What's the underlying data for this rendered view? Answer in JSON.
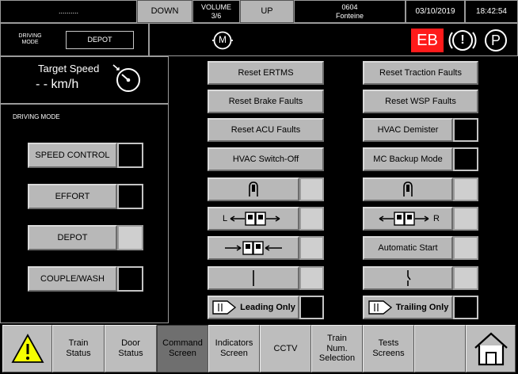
{
  "header": {
    "dots": "..........",
    "down_label": "DOWN",
    "volume_label": "VOLUME",
    "volume_value": "3/6",
    "up_label": "UP",
    "train_number": "0604",
    "station": "Fonteine",
    "date": "03/10/2019",
    "time": "18:42:54"
  },
  "mode_bar": {
    "driving_mode_label": "DRIVING\nMODE",
    "driving_mode_value": "DEPOT",
    "motor_label": "M",
    "eb_label": "EB",
    "warning_symbol": "!",
    "parking_label": "P"
  },
  "target_speed": {
    "title": "Target Speed",
    "value": "- - km/h"
  },
  "driving_mode_panel": {
    "title": "DRIVING MODE",
    "modes": [
      {
        "label": "SPEED CONTROL",
        "active": false
      },
      {
        "label": "EFFORT",
        "active": false
      },
      {
        "label": "DEPOT",
        "active": true
      },
      {
        "label": "COUPLE/WASH",
        "active": false
      }
    ]
  },
  "commands": {
    "reset_ertms": "Reset ERTMS",
    "reset_traction": "Reset Traction Faults",
    "reset_brake": "Reset Brake Faults",
    "reset_wsp": "Reset WSP Faults",
    "reset_acu": "Reset ACU Faults",
    "hvac_demister": "HVAC Demister",
    "hvac_switch_off": "HVAC Switch-Off",
    "mc_backup": "MC Backup Mode",
    "door_left_label": "L",
    "door_right_label": "R",
    "automatic_start": "Automatic Start",
    "leading_only": "Leading Only",
    "trailing_only": "Trailing Only"
  },
  "nav": {
    "warning_icon": "warning-triangle",
    "items": [
      {
        "label": "Train\nStatus"
      },
      {
        "label": "Door\nStatus"
      },
      {
        "label": "Command\nScreen"
      },
      {
        "label": "Indicators\nScreen"
      },
      {
        "label": "CCTV"
      },
      {
        "label": "Train\nNum.\nSelection"
      },
      {
        "label": "Tests\nScreens"
      },
      {
        "label": ""
      }
    ],
    "home_icon": "home"
  }
}
